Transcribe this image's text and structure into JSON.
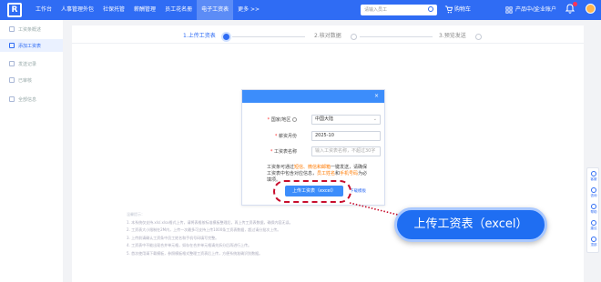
{
  "topbar": {
    "logo_letter": "R",
    "nav": [
      "工作台",
      "人事管理外包",
      "社保托管",
      "薪酬管理",
      "员工花名册",
      "电子工资表",
      "更多 >>"
    ],
    "active_nav": 5,
    "search_placeholder": "请输入员工",
    "buy_car": "购物车",
    "product_center": "产品中心",
    "enterprise_account": "企业账户",
    "badge_count": "5"
  },
  "sidebar": {
    "items": [
      "工资条概述",
      "添加工资表",
      "发送记录",
      "已审核",
      "全部信息"
    ],
    "active": 1
  },
  "steps": {
    "step1": "1.上传工资表",
    "step2": "2.核对数据",
    "step3": "3.预览发送"
  },
  "form": {
    "header_close": "×",
    "region_label": "国家/地区",
    "region_value": "中国大陆",
    "month_label": "薪资月份",
    "month_value": "2025-10",
    "name_label": "工资表名称",
    "name_placeholder": "输入工资表名称，不超过30字",
    "tip_part1": "工资条可通过",
    "tip_orange1": "短信、微信和邮箱",
    "tip_part2": "一键发送，请确保工资表中包含对应信息，",
    "tip_orange2": "员工姓名",
    "tip_part3": "和",
    "tip_orange3": "手机号码",
    "tip_part4": "为必填项。",
    "upload_button": "上传工资表（excel）",
    "download_link": "下载模板"
  },
  "callout": "上传工资表（excel）",
  "notes": [
    "温馨提示：",
    "1. 本系统仅支持.xls/.xlsx格式上传，请将表格按标准模板整理后，再上传工资表数据，确保内容无误。",
    "2. 工资表大小限制在2M内，上传一次最多可支持上传1000条工资表数据，超过请分批次上传。",
    "3. 上传前请确认工资条中员工姓名和手机号码填写完整。",
    "4. 工资表中不能出现合并单元格，如存在合并单元格请先拆分后再进行上传。",
    "5. 首次使用请下载模板，参照模板格式整理工资表后上传，方便系统准确识别数据。"
  ],
  "right_tools": [
    "客服",
    "咨询",
    "帮助",
    "建议",
    "顶部"
  ]
}
